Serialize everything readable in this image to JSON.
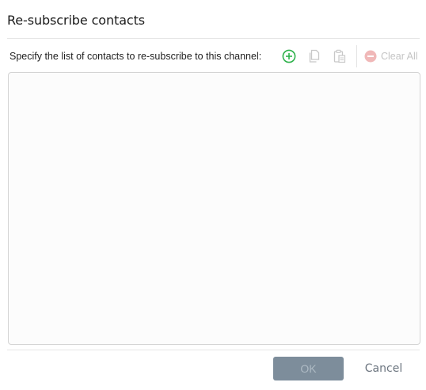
{
  "dialog": {
    "title": "Re-subscribe contacts",
    "instruction": "Specify the list of contacts to re-subscribe to this channel:"
  },
  "toolbar": {
    "add_icon": "plus-circle-icon",
    "copy_icon": "copy-icon",
    "paste_icon": "paste-icon",
    "clear_icon": "minus-circle-icon",
    "clear_all_label": "Clear All"
  },
  "contacts": {
    "value": "",
    "placeholder": ""
  },
  "footer": {
    "ok_label": "OK",
    "cancel_label": "Cancel"
  },
  "colors": {
    "add_accent": "#2fb24c",
    "disabled": "#c4c4c4",
    "clear_disabled": "#f0b8b8",
    "ok_disabled_bg": "#7d8d9b"
  }
}
